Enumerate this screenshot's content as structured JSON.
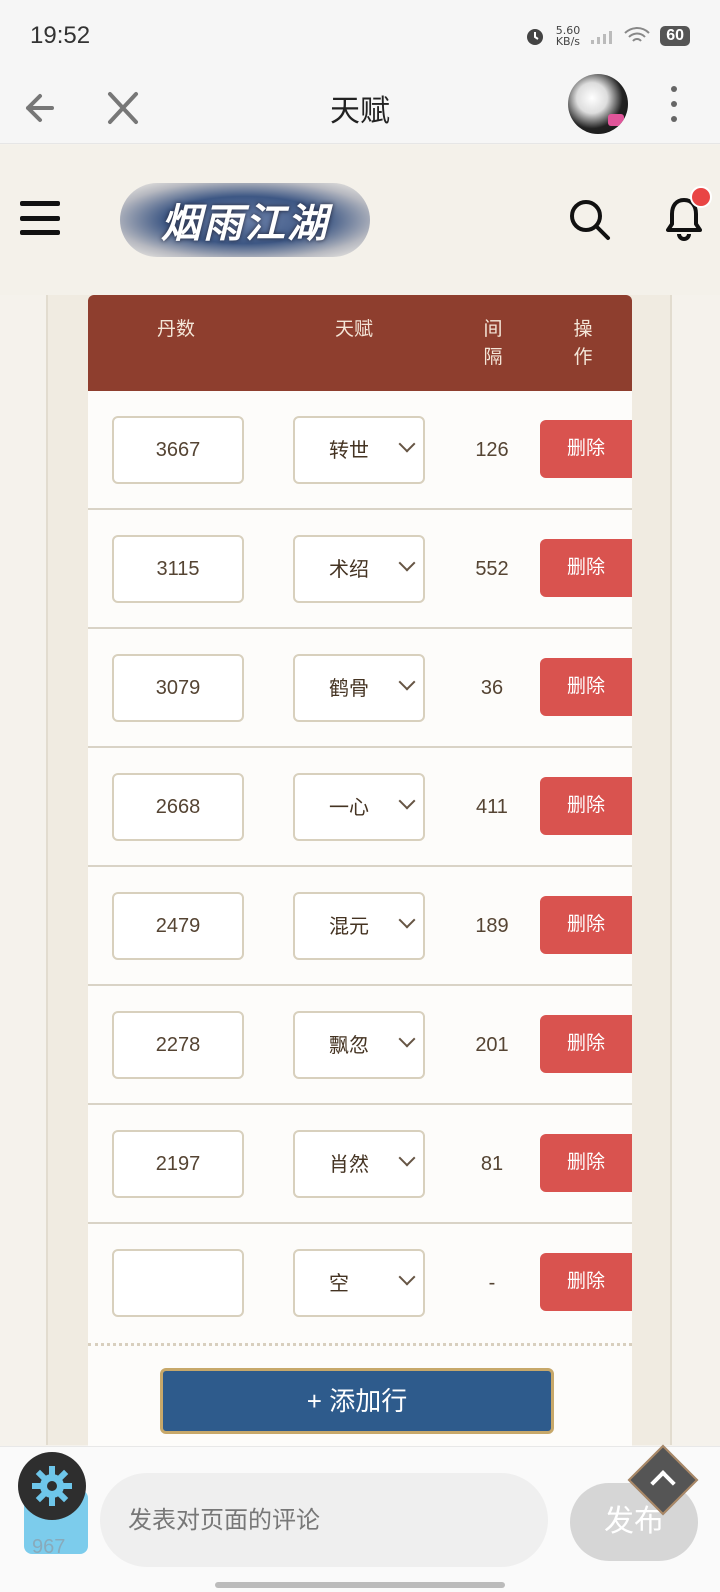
{
  "status_bar": {
    "time": "19:52",
    "net_speed_value": "5.60",
    "net_speed_unit": "KB/s",
    "battery": "60"
  },
  "top_bar": {
    "title": "天赋"
  },
  "site_header": {
    "logo_text": "烟雨江湖"
  },
  "table": {
    "headers": {
      "dan": "丹数",
      "talent": "天赋",
      "interval_1": "间",
      "interval_2": "隔",
      "action_1": "操",
      "action_2": "作"
    },
    "rows": [
      {
        "dan": "3667",
        "talent": "转世",
        "interval": "126",
        "action": "删除"
      },
      {
        "dan": "3115",
        "talent": "术绍",
        "interval": "552",
        "action": "删除"
      },
      {
        "dan": "3079",
        "talent": "鹤骨",
        "interval": "36",
        "action": "删除"
      },
      {
        "dan": "2668",
        "talent": "一心",
        "interval": "411",
        "action": "删除"
      },
      {
        "dan": "2479",
        "talent": "混元",
        "interval": "189",
        "action": "删除"
      },
      {
        "dan": "2278",
        "talent": "飘忽",
        "interval": "201",
        "action": "删除"
      },
      {
        "dan": "2197",
        "talent": "肖然",
        "interval": "81",
        "action": "删除"
      },
      {
        "dan": "",
        "talent": "空",
        "interval": "-",
        "action": "删除"
      }
    ],
    "add_row_label": "+ 添加行"
  },
  "bottom": {
    "comment_placeholder": "发表对页面的评论",
    "publish_label": "发布",
    "badge_count": "967"
  },
  "colors": {
    "header_red": "#8e3e2e",
    "delete_red": "#d9534f",
    "add_blue": "#2e5b8c",
    "notification_dot": "#e94545"
  }
}
